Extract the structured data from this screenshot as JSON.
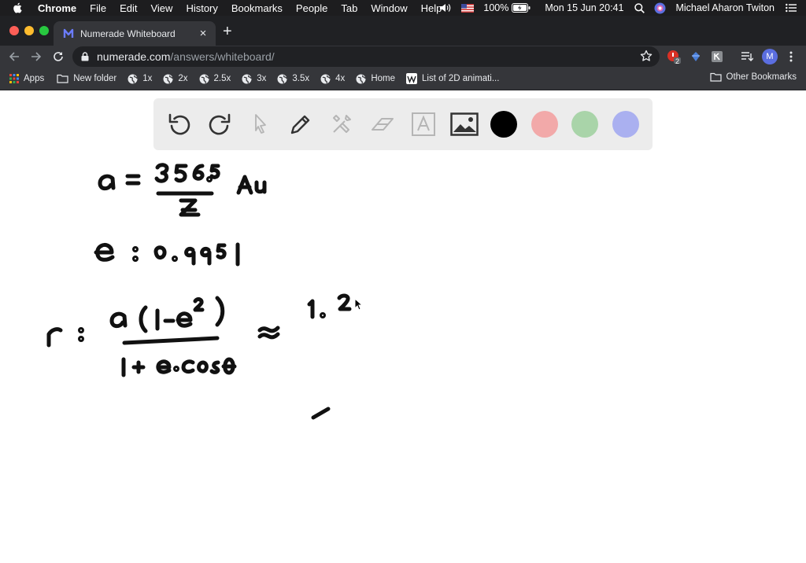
{
  "menubar": {
    "app_name": "Chrome",
    "menus": [
      "File",
      "Edit",
      "View",
      "History",
      "Bookmarks",
      "People",
      "Tab",
      "Window",
      "Help"
    ],
    "battery": "100%",
    "datetime": "Mon 15 Jun  20:41",
    "user": "Michael Aharon Twiton"
  },
  "tab": {
    "title": "Numerade Whiteboard",
    "close_symbol": "×",
    "new_tab_symbol": "+"
  },
  "address": {
    "domain": "numerade.com",
    "path": "/answers/whiteboard/"
  },
  "extensions": {
    "badge_count": "2",
    "profile_initial": "M"
  },
  "bookmarks": {
    "items": [
      "Apps",
      "New folder",
      "1x",
      "2x",
      "2.5x",
      "3x",
      "3.5x",
      "4x",
      "Home",
      "List of 2D animati..."
    ],
    "other": "Other Bookmarks"
  },
  "whiteboard": {
    "tools": [
      "undo-icon",
      "redo-icon",
      "select-icon",
      "pen-icon",
      "tools-icon",
      "eraser-icon",
      "text-icon",
      "image-icon"
    ],
    "colors": [
      "#000000",
      "#f2a9a9",
      "#a9d4a9",
      "#aab0f0"
    ]
  }
}
